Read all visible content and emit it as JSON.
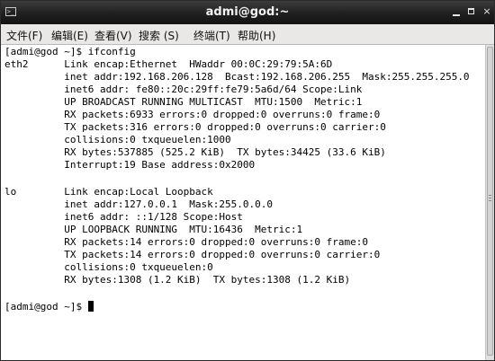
{
  "window": {
    "title": "admi@god:~",
    "icon": "terminal-icon",
    "controls": {
      "minimize": "minimize",
      "maximize": "maximize",
      "close": "×"
    }
  },
  "menu": {
    "items": [
      {
        "label": "文件(F)",
        "name": "menu-file"
      },
      {
        "label": "编辑(E)",
        "name": "menu-edit"
      },
      {
        "label": "查看(V)",
        "name": "menu-view"
      },
      {
        "label": "搜索 (S)",
        "name": "menu-search"
      },
      {
        "label": "终端(T)",
        "name": "menu-terminal"
      },
      {
        "label": "帮助(H)",
        "name": "menu-help"
      }
    ]
  },
  "terminal": {
    "lines": [
      "[admi@god ~]$ ifconfig",
      "eth2      Link encap:Ethernet  HWaddr 00:0C:29:79:5A:6D",
      "          inet addr:192.168.206.128  Bcast:192.168.206.255  Mask:255.255.255.0",
      "          inet6 addr: fe80::20c:29ff:fe79:5a6d/64 Scope:Link",
      "          UP BROADCAST RUNNING MULTICAST  MTU:1500  Metric:1",
      "          RX packets:6933 errors:0 dropped:0 overruns:0 frame:0",
      "          TX packets:316 errors:0 dropped:0 overruns:0 carrier:0",
      "          collisions:0 txqueuelen:1000",
      "          RX bytes:537885 (525.2 KiB)  TX bytes:34425 (33.6 KiB)",
      "          Interrupt:19 Base address:0x2000",
      "",
      "lo        Link encap:Local Loopback",
      "          inet addr:127.0.0.1  Mask:255.0.0.0",
      "          inet6 addr: ::1/128 Scope:Host",
      "          UP LOOPBACK RUNNING  MTU:16436  Metric:1",
      "          RX packets:14 errors:0 dropped:0 overruns:0 frame:0",
      "          TX packets:14 errors:0 dropped:0 overruns:0 carrier:0",
      "          collisions:0 txqueuelen:0",
      "          RX bytes:1308 (1.2 KiB)  TX bytes:1308 (1.2 KiB)",
      "",
      "[admi@god ~]$ "
    ]
  }
}
